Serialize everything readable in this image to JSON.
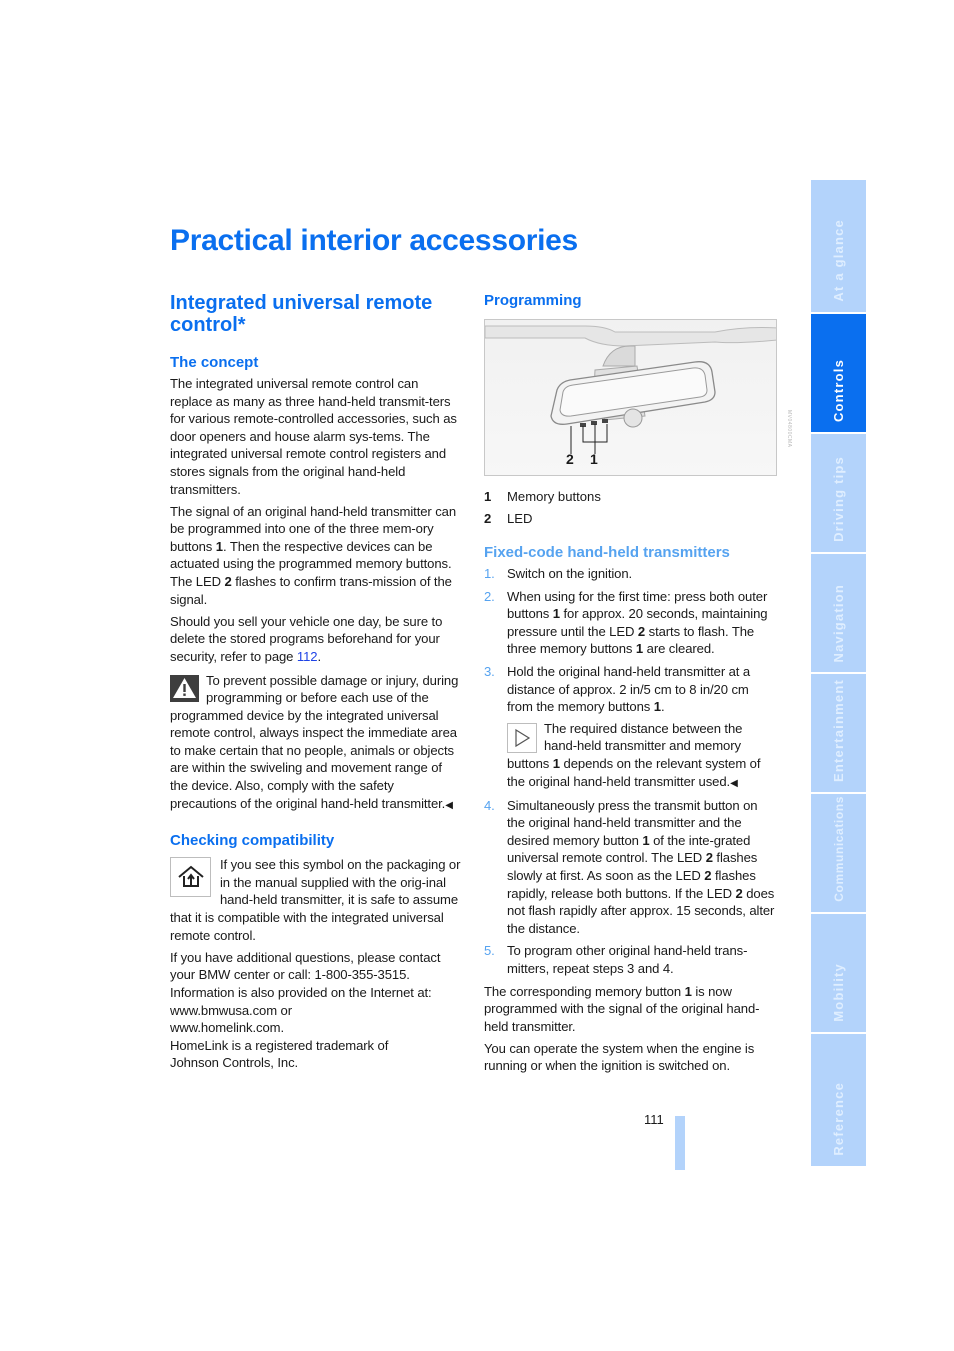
{
  "page_title": "Practical interior accessories",
  "left": {
    "section_title": "Integrated universal remote control*",
    "concept": {
      "heading": "The concept",
      "para1": "The integrated universal remote control can replace as many as three hand-held transmit-ters for various remote-controlled accessories, such as door openers and house alarm sys-tems. The integrated universal remote control registers and stores signals from the original hand-held transmitters.",
      "para2_a": "The signal of an original hand-held transmitter can be programmed into one of the three mem-ory buttons ",
      "para2_b1": "1",
      "para2_c": ". Then the respective devices can be actuated using the programmed memory buttons. The LED ",
      "para2_b2": "2",
      "para2_d": " flashes to confirm trans-mission of the signal.",
      "para3_a": "Should you sell your vehicle one day, be sure to delete the stored programs beforehand for your security, refer to page ",
      "para3_link": "112",
      "para3_b": ".",
      "warning": "To prevent possible damage or injury, during programming or before each use of the programmed device by the integrated universal remote control, always inspect the immediate area to make certain that no people, animals or objects are within the swiveling and movement range of the device. Also, comply with the safety precautions of the original hand-held transmitter.",
      "end_mark": "◀"
    },
    "compat": {
      "heading": "Checking compatibility",
      "para1": "If you see this symbol on the packaging or in the manual supplied with the orig-inal hand-held transmitter, it is safe to assume that it is compatible with the integrated universal remote control.",
      "contact_lines": [
        "If you have additional questions, please contact your BMW center or call: 1-800-355-3515.",
        "Information is also provided on the Internet at:",
        "www.bmwusa.com or",
        "www.homelink.com.",
        "HomeLink is a registered trademark of",
        "Johnson Controls, Inc."
      ]
    }
  },
  "right": {
    "programming_heading": "Programming",
    "figure": {
      "callout_2": "2",
      "callout_1": "1",
      "code": "MV04800CMA"
    },
    "legend": [
      {
        "num": "1",
        "label": "Memory buttons"
      },
      {
        "num": "2",
        "label": "LED"
      }
    ],
    "fixed_code_heading": "Fixed-code hand-held transmitters",
    "steps": [
      {
        "num": "1.",
        "parts": [
          "Switch on the ignition."
        ]
      },
      {
        "num": "2.",
        "parts": [
          "When using for the first time: press both outer buttons ",
          "1",
          " for approx. 20 seconds, maintaining pressure until the LED ",
          "2",
          " starts to flash. The three memory buttons ",
          "1",
          " are cleared."
        ]
      },
      {
        "num": "3.",
        "parts": [
          "Hold the original hand-held transmitter at a distance of approx. 2 in/5 cm to 8 in/20 cm from the memory buttons ",
          "1",
          "."
        ]
      },
      {
        "num": "4.",
        "parts": [
          "Simultaneously press the transmit button on the original hand-held transmitter and the desired memory button ",
          "1",
          " of the inte-grated universal remote control. The LED ",
          "2",
          " flashes slowly at first. As soon as the LED ",
          "2",
          " flashes rapidly, release both buttons. If the LED ",
          "2",
          " does not flash rapidly after approx. 15 seconds, alter the distance."
        ]
      },
      {
        "num": "5.",
        "parts": [
          "To program other original hand-held trans-mitters, repeat steps 3 and 4."
        ]
      }
    ],
    "note": {
      "a": "The required distance between the hand-held transmitter and memory buttons ",
      "b": "1",
      "c": " depends on the relevant system of the original hand-held transmitter used.",
      "end_mark": "◀"
    },
    "closing_a": "The corresponding memory button ",
    "closing_b": "1",
    "closing_c": " is now programmed with the signal of the original hand-held transmitter.",
    "closing2": "You can operate the system when the engine is running or when the ignition is switched on."
  },
  "page_number": "111",
  "side_nav": {
    "active": "Controls",
    "items": [
      "At a glance",
      "Controls",
      "Driving tips",
      "Navigation",
      "Entertainment",
      "Communications",
      "Mobility",
      "Reference"
    ]
  },
  "colors": {
    "heading_blue": "#0a6fef",
    "list_number_blue": "#56a3f0",
    "link_blue": "#1f43e6",
    "side_tab": "#b3d3fb",
    "side_tab_active": "#0a6fef"
  },
  "icons": {
    "warning": "warning-triangle-icon",
    "compat": "homelink-house-icon",
    "note": "note-triangle-icon"
  }
}
